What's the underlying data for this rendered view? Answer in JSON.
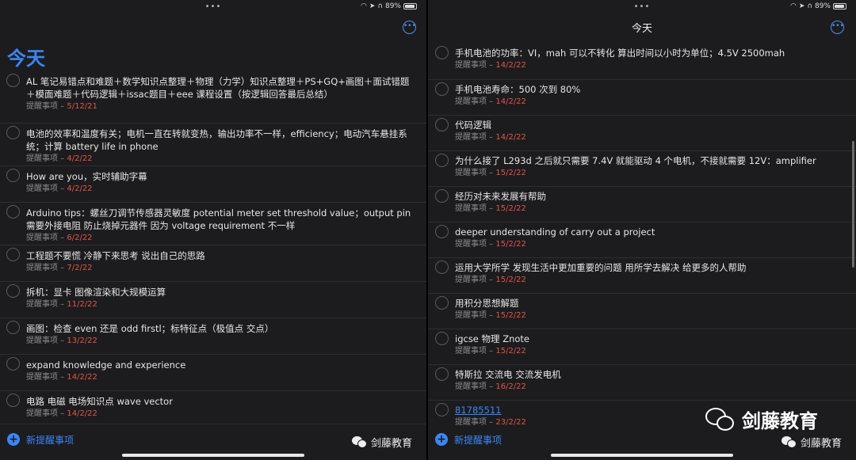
{
  "status": {
    "dots": "•••",
    "battery": "89%"
  },
  "left": {
    "title": "今天",
    "items": [
      {
        "title": "AL 笔记易错点和难题＋数学知识点整理＋物理（力学）知识点整理＋PS+GQ+画图＋面试错题＋模面难题＋代码逻辑＋issac题目＋eee 课程设置（按逻辑回答最后总结）",
        "label": "提醒事项 – ",
        "date": "5/12/21"
      },
      {
        "title": "电池的效率和温度有关；电机一直在转就变热，输出功率不一样，efficiency；电动汽车悬挂系统；计算 battery life in phone",
        "label": "提醒事项 – ",
        "date": "4/2/22"
      },
      {
        "title": "How are you，实时辅助字幕",
        "label": "提醒事项 – ",
        "date": "4/2/22"
      },
      {
        "title": "Arduino tips：螺丝刀调节传感器灵敏度 potential meter set threshold value；output pin 需要外接电阻 防止烧掉元器件 因为 voltage requirement 不一样",
        "label": "提醒事项 – ",
        "date": "6/2/22"
      },
      {
        "title": "工程题不要慌 冷静下来思考 说出自己的思路",
        "label": "提醒事项 – ",
        "date": "7/2/22"
      },
      {
        "title": "拆机：显卡 图像渲染和大规模运算",
        "label": "提醒事项 – ",
        "date": "11/2/22"
      },
      {
        "title": "画图：检查 even 还是 odd firstl；标特征点（极值点 交点）",
        "label": "提醒事项 – ",
        "date": "13/2/22"
      },
      {
        "title": "expand knowledge and experience",
        "label": "提醒事项 – ",
        "date": "14/2/22"
      },
      {
        "title": "电路 电磁 电场知识点 wave vector",
        "label": "提醒事项 – ",
        "date": "14/2/22"
      }
    ],
    "new_label": "新提醒事项",
    "brand": "剑藤教育"
  },
  "right": {
    "title": "今天",
    "items": [
      {
        "title": "手机电池的功率：VI，mah 可以不转化 算出时间以小时为单位；4.5V 2500mah",
        "label": "提醒事项 – ",
        "date": "14/2/22",
        "link": false
      },
      {
        "title": "手机电池寿命：500 次到 80%",
        "label": "提醒事项 – ",
        "date": "14/2/22",
        "link": false
      },
      {
        "title": "代码逻辑",
        "label": "提醒事项 – ",
        "date": "14/2/22",
        "link": false
      },
      {
        "title": "为什么接了 L293d 之后就只需要 7.4V 就能驱动 4 个电机，不接就需要 12V：amplifier",
        "label": "提醒事项 – ",
        "date": "15/2/22",
        "link": false
      },
      {
        "title": "经历对未来发展有帮助",
        "label": "提醒事项 – ",
        "date": "15/2/22",
        "link": false
      },
      {
        "title": "deeper understanding of carry out a project",
        "label": "提醒事项 – ",
        "date": "15/2/22",
        "link": false
      },
      {
        "title": "运用大学所学 发现生活中更加重要的问题 用所学去解决 给更多的人帮助",
        "label": "提醒事项 – ",
        "date": "15/2/22",
        "link": false
      },
      {
        "title": "用积分思想解题",
        "label": "提醒事项 – ",
        "date": "15/2/22",
        "link": false
      },
      {
        "title": "igcse 物理 Znote",
        "label": "提醒事项 – ",
        "date": "15/2/22",
        "link": false
      },
      {
        "title": "特斯拉 交流电 交流发电机",
        "label": "提醒事项 – ",
        "date": "16/2/22",
        "link": false
      },
      {
        "title": "81785511",
        "label": "提醒事项 – ",
        "date": "23/2/22",
        "link": true
      }
    ],
    "new_label": "新提醒事项",
    "brand": "剑藤教育"
  },
  "watermark": "剑藤教育"
}
